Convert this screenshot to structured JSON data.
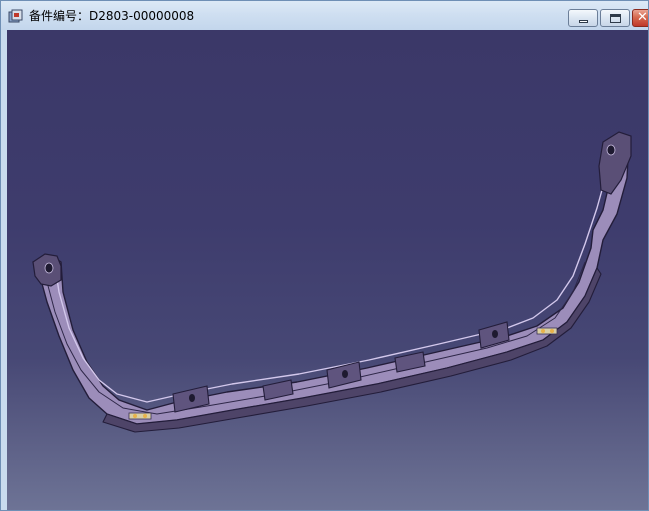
{
  "window": {
    "title": "备件编号：D2803-00000008",
    "icon": "catia-part-icon",
    "controls": {
      "minimize": "minimize-icon",
      "maximize": "maximize-icon",
      "close": "close-icon"
    }
  },
  "colors": {
    "viewport_top": "#3b3868",
    "viewport_bottom": "#6e7496",
    "part_face": "#9f8fbe",
    "part_edge": "#2a2440",
    "titlebar": "#cfdff1"
  }
}
